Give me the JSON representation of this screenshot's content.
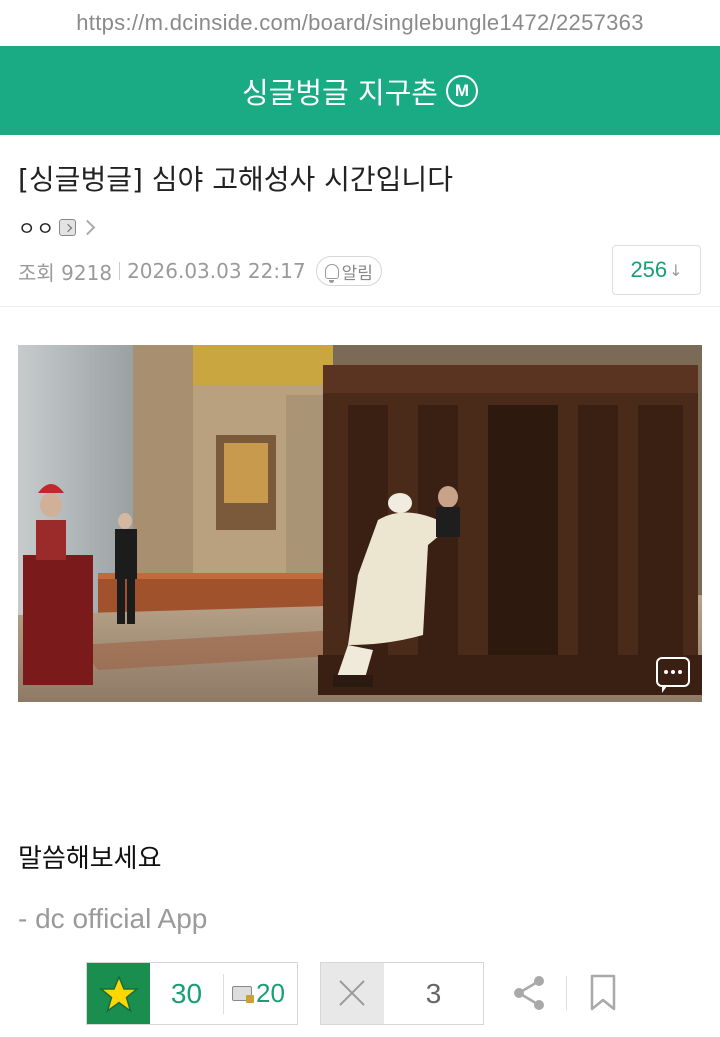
{
  "browser": {
    "url": "https://m.dcinside.com/board/singlebungle1472/2257363"
  },
  "header": {
    "gallery_title": "싱글벙글 지구촌",
    "badge_label": "M"
  },
  "post": {
    "title": "[싱글벙글] 심야 고해성사 시간입니다",
    "writer": "ㅇㅇ",
    "views": "조회 9218",
    "datetime": "2026.03.03 22:17",
    "notify_label": "알림",
    "comment_count": "256",
    "comment_count_arrow": "↓",
    "body_text": "말씀해보세요",
    "signature": "- dc official App"
  },
  "actions": {
    "recommend_count": "30",
    "fixed_recommend_count": "20",
    "downvote_count": "3"
  },
  "colors": {
    "brand_green": "#1aab84",
    "star_green": "#1a8e4f",
    "count_green": "#15a078"
  },
  "icons": [
    "minor-gallery-badge-icon",
    "writer-icon",
    "chevron-right-icon",
    "bell-icon",
    "down-arrow-icon",
    "comment-icon",
    "star-icon",
    "fixed-user-icon",
    "x-icon",
    "share-icon",
    "bookmark-icon"
  ]
}
